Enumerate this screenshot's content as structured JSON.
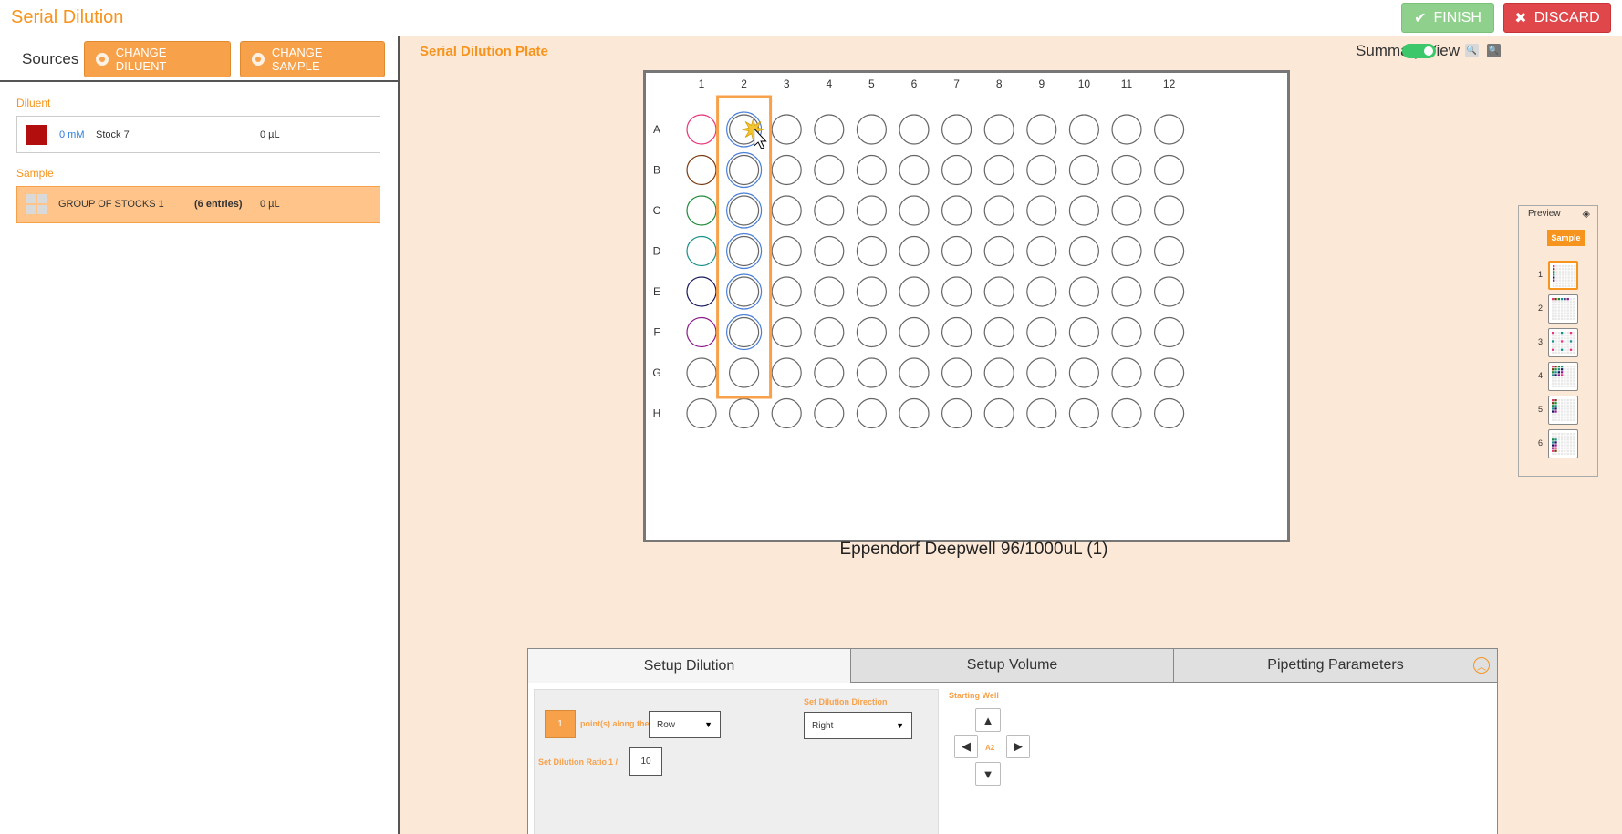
{
  "app": {
    "title": "Serial Dilution",
    "finish_label": "FINISH",
    "discard_label": "DISCARD"
  },
  "sources": {
    "label": "Sources",
    "change_diluent_label": "CHANGE DILUENT",
    "change_sample_label": "CHANGE SAMPLE",
    "diluent": {
      "section_label": "Diluent",
      "concentration": "0 mM",
      "name": "Stock 7",
      "volume": "0 µL",
      "color": "#b20e0e"
    },
    "sample": {
      "section_label": "Sample",
      "name": "GROUP OF STOCKS 1",
      "entries": "(6 entries)",
      "volume": "0 µL"
    }
  },
  "plate": {
    "section_title": "Serial Dilution Plate",
    "summary_view_label": "Summary View",
    "summary_view_on": true,
    "name": "Eppendorf Deepwell 96/1000uL (1)",
    "columns": [
      "1",
      "2",
      "3",
      "4",
      "5",
      "6",
      "7",
      "8",
      "9",
      "10",
      "11",
      "12"
    ],
    "rows": [
      "A",
      "B",
      "C",
      "D",
      "E",
      "F",
      "G",
      "H"
    ],
    "sample_wells": [
      {
        "well": "A1",
        "color": "#e8347a"
      },
      {
        "well": "B1",
        "color": "#7a3b12"
      },
      {
        "well": "C1",
        "color": "#1f8a3a"
      },
      {
        "well": "D1",
        "color": "#16908a"
      },
      {
        "well": "E1",
        "color": "#17175e"
      },
      {
        "well": "F1",
        "color": "#8a1a8a"
      }
    ],
    "target_wells": [
      "A2",
      "B2",
      "C2",
      "D2",
      "E2",
      "F2"
    ],
    "target_color": "#4a7fd6",
    "highlight_column": "2",
    "highlight_color": "#f7a14a"
  },
  "preview": {
    "title": "Preview",
    "sample_label": "Sample",
    "items": [
      {
        "num": "1",
        "active": true
      },
      {
        "num": "2",
        "active": false
      },
      {
        "num": "3",
        "active": false
      },
      {
        "num": "4",
        "active": false
      },
      {
        "num": "5",
        "active": false
      },
      {
        "num": "6",
        "active": false
      }
    ]
  },
  "setup": {
    "tabs": [
      {
        "label": "Setup Dilution",
        "active": true
      },
      {
        "label": "Setup Volume",
        "active": false
      },
      {
        "label": "Pipetting Parameters",
        "active": false
      }
    ],
    "points_value": "1",
    "points_text": "point(s) along the",
    "along_select": "Row",
    "ratio_label": "Set Dilution Ratio",
    "ratio_prefix": "1 /",
    "ratio_value": "10",
    "direction_label": "Set Dilution Direction",
    "direction_select": "Right",
    "starting_well_label": "Starting Well",
    "starting_well_value": "A2"
  },
  "colors": {
    "accent": "#f7941d",
    "finish": "#8fd08c",
    "discard": "#e0474b",
    "panel_bg": "#fce8d6"
  }
}
